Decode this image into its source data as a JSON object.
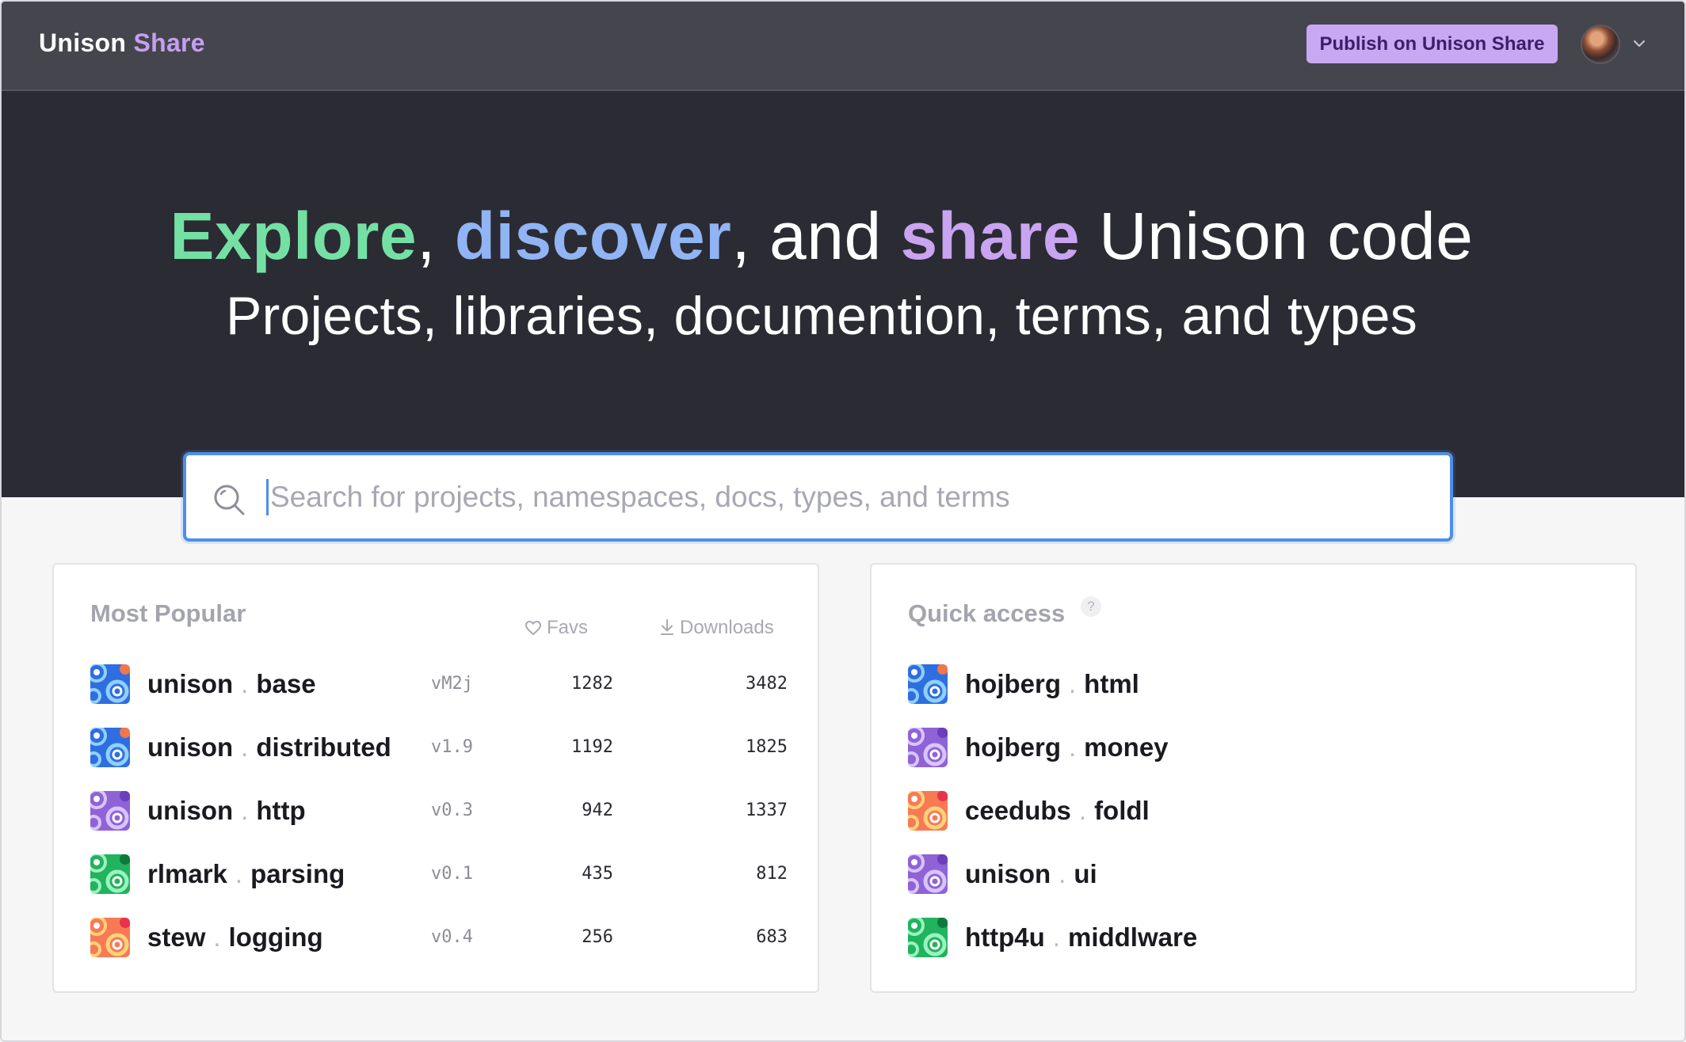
{
  "header": {
    "logo_part1": "Unison",
    "logo_part2": "Share",
    "publish_label": "Publish on Unison Share"
  },
  "hero": {
    "explore": "Explore",
    "comma1": ", ",
    "discover": "discover",
    "and": ", and ",
    "share": "share",
    "rest": " Unison code",
    "subtitle": "Projects, libraries, documention, terms, and types"
  },
  "search": {
    "placeholder": "Search for projects, namespaces, docs, types, and terms",
    "value": ""
  },
  "most_popular": {
    "title": "Most Popular",
    "favs_header": "Favs",
    "downloads_header": "Downloads",
    "items": [
      {
        "owner": "unison",
        "sep": ".",
        "name": "base",
        "version": "vM2j",
        "favs": "1282",
        "downloads": "3482",
        "icon_color": "blue"
      },
      {
        "owner": "unison",
        "sep": ".",
        "name": "distributed",
        "version": "v1.9",
        "favs": "1192",
        "downloads": "1825",
        "icon_color": "blue"
      },
      {
        "owner": "unison",
        "sep": ".",
        "name": "http",
        "version": "v0.3",
        "favs": "942",
        "downloads": "1337",
        "icon_color": "purple"
      },
      {
        "owner": "rlmark",
        "sep": ".",
        "name": "parsing",
        "version": "v0.1",
        "favs": "435",
        "downloads": "812",
        "icon_color": "green"
      },
      {
        "owner": "stew",
        "sep": ".",
        "name": "logging",
        "version": "v0.4",
        "favs": "256",
        "downloads": "683",
        "icon_color": "orange"
      }
    ]
  },
  "quick_access": {
    "title": "Quick access",
    "help": "?",
    "items": [
      {
        "owner": "hojberg",
        "sep": ".",
        "name": "html",
        "icon_color": "blue"
      },
      {
        "owner": "hojberg",
        "sep": ".",
        "name": "money",
        "icon_color": "purple"
      },
      {
        "owner": "ceedubs",
        "sep": ".",
        "name": "foldl",
        "icon_color": "orange"
      },
      {
        "owner": "unison",
        "sep": ".",
        "name": "ui",
        "icon_color": "purple"
      },
      {
        "owner": "http4u",
        "sep": ".",
        "name": "middlware",
        "icon_color": "green"
      }
    ]
  },
  "colors": {
    "accent_blue": "#4f8ee8",
    "explore_green": "#74e0a4",
    "discover_blue": "#90b4f4",
    "share_purple": "#c9a4f0",
    "publish_bg": "#c9a8f3"
  }
}
